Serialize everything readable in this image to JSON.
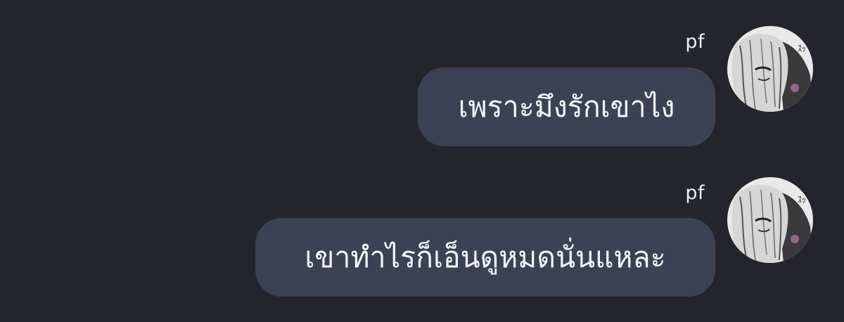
{
  "messages": [
    {
      "sender": "pf",
      "text": "เพราะมึงรักเขาไง",
      "avatar_icon": "anime-character-avatar-icon"
    },
    {
      "sender": "pf",
      "text": "เขาทำไรก็เอ็นดูหมดนั่นแหละ",
      "avatar_icon": "anime-character-avatar-icon"
    }
  ],
  "colors": {
    "background": "#24252c",
    "bubble": "#3b4253",
    "text": "#f4f5f8"
  }
}
